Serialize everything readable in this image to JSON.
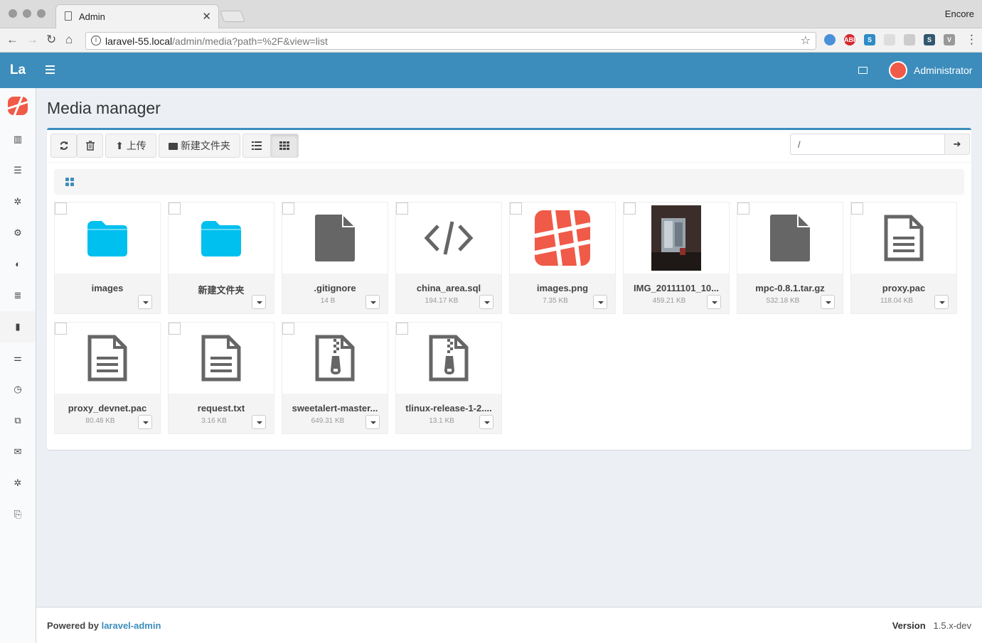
{
  "browser": {
    "tab_title": "Admin",
    "profile": "Encore",
    "url_host": "laravel-55.local",
    "url_path": "/admin/media?path=%2F&view=list"
  },
  "header": {
    "logo": "La",
    "user_name": "Administrator"
  },
  "page": {
    "title": "Media manager"
  },
  "toolbar": {
    "upload_label": "上传",
    "new_folder_label": "新建文件夹",
    "path_value": "/"
  },
  "files": [
    {
      "name": "images",
      "size": "",
      "type": "folder"
    },
    {
      "name": "新建文件夹",
      "size": "",
      "type": "folder"
    },
    {
      "name": ".gitignore",
      "size": "14 B",
      "type": "file"
    },
    {
      "name": "china_area.sql",
      "size": "194.17 KB",
      "type": "code"
    },
    {
      "name": "images.png",
      "size": "7.35 KB",
      "type": "image-logo"
    },
    {
      "name": "IMG_20111101_10...",
      "size": "459.21 KB",
      "type": "image-photo"
    },
    {
      "name": "mpc-0.8.1.tar.gz",
      "size": "532.18 KB",
      "type": "file"
    },
    {
      "name": "proxy.pac",
      "size": "118.04 KB",
      "type": "text"
    },
    {
      "name": "proxy_devnet.pac",
      "size": "80.48 KB",
      "type": "text"
    },
    {
      "name": "request.txt",
      "size": "3.16 KB",
      "type": "text"
    },
    {
      "name": "sweetalert-master...",
      "size": "649.31 KB",
      "type": "zip"
    },
    {
      "name": "tlinux-release-1-2....",
      "size": "13.1 KB",
      "type": "zip"
    }
  ],
  "footer": {
    "powered_by": "Powered by",
    "link": "laravel-admin",
    "version_label": "Version",
    "version": "1.5.x-dev"
  },
  "colors": {
    "primary": "#3c8dbc",
    "folder": "#00c0ef",
    "laravel": "#f05a48"
  }
}
